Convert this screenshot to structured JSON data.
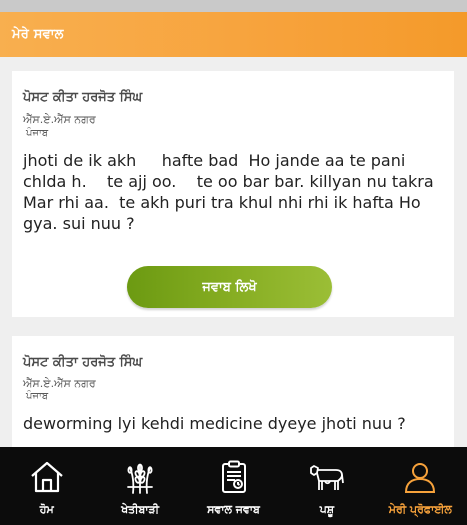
{
  "header": {
    "title": "ਮੇਰੇ ਸਵਾਲ"
  },
  "posts": [
    {
      "posted_by": "ਪੋਸਟ ਕੀਤਾ ਹਰਜੋਤ ਸਿੰਘ",
      "village": "ਐੱਸ.ਏ.ਐੱਸ ਨਗਰ",
      "state": "ਪੰਜਾਬ",
      "question": "jhoti de ik akh     hafte bad  Ho jande aa te pani chlda h.    te ajj oo.    te oo bar bar. killyan nu takra Mar rhi aa.  te akh puri tra khul nhi rhi ik hafta Ho gya. sui nuu ?",
      "answer_label": "ਜਵਾਬ ਲਿਖੋ"
    },
    {
      "posted_by": "ਪੋਸਟ ਕੀਤਾ ਹਰਜੋਤ ਸਿੰਘ",
      "village": "ਐੱਸ.ਏ.ਐੱਸ ਨਗਰ",
      "state": "ਪੰਜਾਬ",
      "question": "deworming lyi kehdi medicine dyeye jhoti nuu ?"
    }
  ],
  "nav": {
    "items": [
      {
        "label": "ਹੋਮ",
        "icon": "home-icon"
      },
      {
        "label": "ਖੇਤੀਬਾੜੀ",
        "icon": "wheat-icon"
      },
      {
        "label": "ਸਵਾਲ ਜਵਾਬ",
        "icon": "clipboard-icon"
      },
      {
        "label": "ਪਸ਼ੂ",
        "icon": "cow-icon"
      },
      {
        "label": "ਮੇਰੀ ਪ੍ਰੋਫਾਈਲ",
        "icon": "profile-icon"
      }
    ],
    "active_index": 4
  },
  "colors": {
    "header_bg": "#f7a23b",
    "active_nav": "#f7a23b",
    "button_green": "#86ad22",
    "nav_bg": "#0c0c0c"
  }
}
